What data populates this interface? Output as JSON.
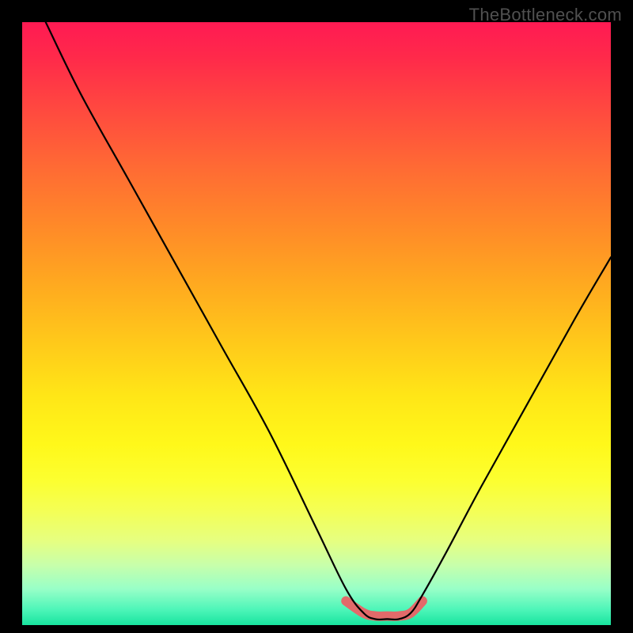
{
  "watermark": "TheBottleneck.com",
  "chart_data": {
    "type": "line",
    "title": "",
    "xlabel": "",
    "ylabel": "",
    "xlim": [
      0,
      100
    ],
    "ylim": [
      0,
      100
    ],
    "grid": false,
    "series": [
      {
        "name": "bottleneck-curve",
        "x": [
          4,
          10,
          18,
          26,
          34,
          42,
          50,
          55,
          58,
          60,
          62,
          64,
          66,
          68,
          72,
          78,
          86,
          94,
          100
        ],
        "y": [
          100,
          88,
          74,
          60,
          46,
          32,
          16,
          6,
          2,
          1,
          1,
          1,
          2,
          5,
          12,
          23,
          37,
          51,
          61
        ]
      },
      {
        "name": "optimal-range-highlight",
        "x": [
          55,
          58,
          60,
          62,
          64,
          66,
          68
        ],
        "y": [
          4,
          2,
          1.5,
          1.5,
          1.5,
          2,
          4
        ]
      }
    ],
    "colors": {
      "top": "#ff1a53",
      "mid": "#ffe617",
      "bottom": "#18e49e",
      "curve": "#000000",
      "accent": "#e26a6a"
    }
  }
}
